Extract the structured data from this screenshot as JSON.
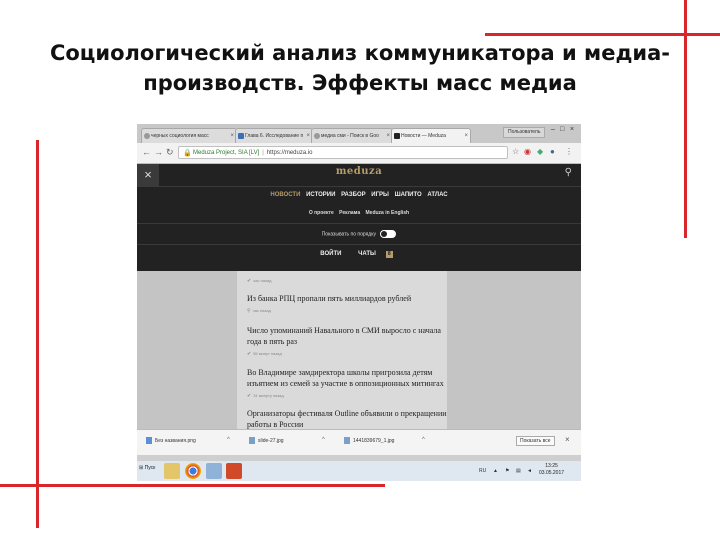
{
  "slide": {
    "title_line1": "Социологический анализ коммуникатора и медиа-",
    "title_line2": "производств. Эффекты масс медиа"
  },
  "browser": {
    "tabs": [
      {
        "label": "черных социология масс"
      },
      {
        "label": "Глава 6. Исследование п"
      },
      {
        "label": "медиа сми - Поиск в Goo"
      },
      {
        "label": "Новости — Meduza"
      }
    ],
    "user_button": "Пользователь",
    "window_controls": [
      "–",
      "□",
      "×"
    ],
    "url_site": "Meduza Project, SIA [LV]",
    "url": "https://meduza.io"
  },
  "meduza_menu": {
    "close_icon": "×",
    "logo": "meduza",
    "search_icon": "⚲",
    "nav": [
      "НОВОСТИ",
      "ИСТОРИИ",
      "РАЗБОР",
      "ИГРЫ",
      "ШАПИТО",
      "АТЛАС"
    ],
    "sub_links": [
      "О проекте",
      "Реклама",
      "Meduza in English"
    ],
    "toggle_label": "Показывать по порядку",
    "bottom_links": {
      "login": "ВОЙТИ",
      "chats": "ЧАТЫ",
      "chats_badge": "8"
    }
  },
  "feed": {
    "items": [
      {
        "title": "",
        "meta": "час назад"
      },
      {
        "title": "Из банка РПЦ пропали пять миллиардов рублей",
        "meta": "час назад"
      },
      {
        "title": "Число упоминаний Навального в СМИ выросло с начала года в пять раз",
        "meta": "55 минут назад"
      },
      {
        "title": "Во Владимире замдиректора школы пригрозила детям изъятием из семей за участие в оппозиционных митингах",
        "meta": "31 минуту назад"
      },
      {
        "title": "Организаторы фестиваля Outline объявили о прекращении работы в России",
        "meta": ""
      }
    ]
  },
  "downloads": {
    "files": [
      "Без названия.png",
      "slide-27.jpg",
      "1441839679_1.jpg"
    ],
    "show_all": "Показать все",
    "close": "×"
  },
  "taskbar": {
    "start": "Пуск",
    "lang": "RU",
    "time": "13:25",
    "date": "03.05.2017"
  },
  "colors": {
    "accent_red": "#d9262b",
    "meduza_gold": "#b89b6a",
    "menu_bg": "#222222"
  }
}
